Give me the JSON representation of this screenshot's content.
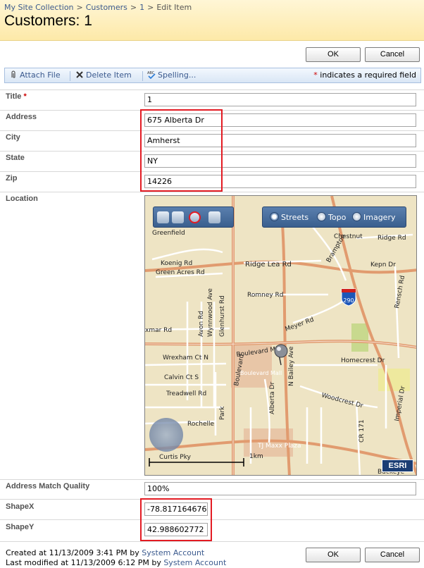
{
  "breadcrumb": {
    "site": "My Site Collection",
    "list": "Customers",
    "item": "1",
    "current": "Edit Item"
  },
  "page_title": "Customers: 1",
  "buttons": {
    "ok": "OK",
    "cancel": "Cancel"
  },
  "toolbar": {
    "attach": "Attach File",
    "delete": "Delete Item",
    "spelling": "Spelling...",
    "required_note": "indicates a required field",
    "required_marker": "*"
  },
  "fields": {
    "title": {
      "label": "Title",
      "value": "1"
    },
    "address": {
      "label": "Address",
      "value": "675 Alberta Dr"
    },
    "city": {
      "label": "City",
      "value": "Amherst"
    },
    "state": {
      "label": "State",
      "value": "NY"
    },
    "zip": {
      "label": "Zip",
      "value": "14226"
    },
    "location": {
      "label": "Location"
    },
    "match_quality": {
      "label": "Address Match Quality",
      "value": "100%"
    },
    "shape_x": {
      "label": "ShapeX",
      "value": "-78.817164676"
    },
    "shape_y": {
      "label": "ShapeY",
      "value": "42.988602772"
    }
  },
  "map": {
    "basemaps": [
      "Streets",
      "Topo",
      "Imagery"
    ],
    "selected_basemap": "Streets",
    "logo": "ESRI",
    "highway_shield": "290",
    "scale_label": "1km",
    "labels": {
      "greenfield": "Greenfield",
      "chestnut": "Chestnut",
      "ridge_rd_ne": "Ridge Rd",
      "koenig": "Koenig Rd",
      "green_acres": "Green Acres Rd",
      "ridge_lea": "Ridge Lea Rd",
      "brampton": "Brampton",
      "kepner": "Kepn Dr",
      "romney": "Romney Rd",
      "wynnwood": "Wynnwood Ave",
      "glenhurst": "Glenhurst Rd",
      "avon": "Avon Rd",
      "meyer": "Meyer Rd",
      "xmar": "xmar Rd",
      "wrexham": "Wrexham Ct N",
      "boulevard_mall_rd": "Boulevard Mall",
      "boulevard_mall": "Boulevard Mall",
      "homecrest": "Homecrest Dr",
      "calvin": "Calvin Ct S",
      "treadwell": "Treadwell Rd",
      "woodcrest": "Woodcrest Dr",
      "rochelle": "Rochelle",
      "park": "Park",
      "alberta": "Alberta Dr",
      "n_bailey": "N Bailey Ave",
      "cr171": "CR 171",
      "imperial": "Imperial Dr",
      "tj_maxx": "TJ Maxx Plaza",
      "curtis": "Curtis Pky",
      "buckeye": "Buckeye",
      "rensch": "Rensch Rd",
      "blvd": "Boulevard"
    }
  },
  "footer": {
    "created_prefix": "Created at 11/13/2009 3:41 PM  by",
    "created_by": "System Account",
    "modified_prefix": "Last modified at 11/13/2009 6:12 PM  by",
    "modified_by": "System Account"
  },
  "colors": {
    "title_band": "#fde9a8",
    "link": "#3b5a8e",
    "highlight": "#e31b23",
    "required": "#cc0000"
  }
}
